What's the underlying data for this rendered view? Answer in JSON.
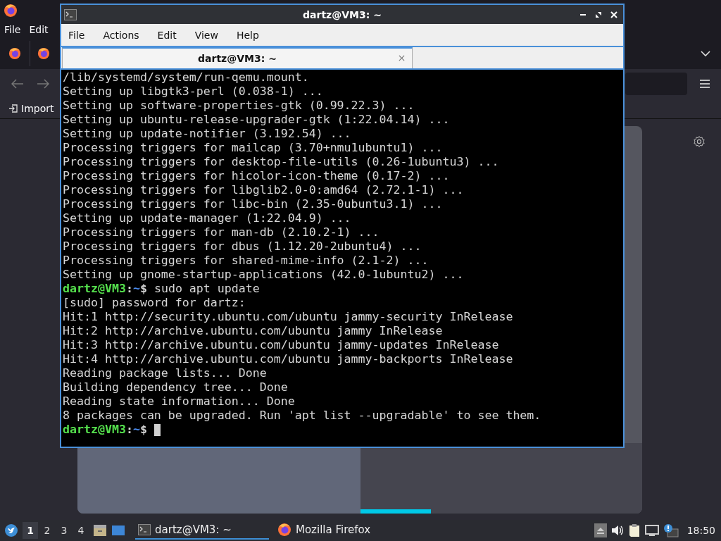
{
  "browser": {
    "menu": [
      "File",
      "Edit"
    ],
    "tabs": [
      {
        "kind": "pinned"
      },
      {
        "kind": "page"
      }
    ],
    "bookmarks": [
      "Import"
    ]
  },
  "terminal": {
    "title": "dartz@VM3: ~",
    "menu": [
      "File",
      "Actions",
      "Edit",
      "View",
      "Help"
    ],
    "tab": {
      "label": "dartz@VM3: ~"
    },
    "lines": [
      {
        "kind": "output",
        "text": "/lib/systemd/system/run-qemu.mount."
      },
      {
        "kind": "output",
        "text": "Setting up libgtk3-perl (0.038-1) ..."
      },
      {
        "kind": "output",
        "text": "Setting up software-properties-gtk (0.99.22.3) ..."
      },
      {
        "kind": "output",
        "text": "Setting up ubuntu-release-upgrader-gtk (1:22.04.14) ..."
      },
      {
        "kind": "output",
        "text": "Setting up update-notifier (3.192.54) ..."
      },
      {
        "kind": "output",
        "text": "Processing triggers for mailcap (3.70+nmu1ubuntu1) ..."
      },
      {
        "kind": "output",
        "text": "Processing triggers for desktop-file-utils (0.26-1ubuntu3) ..."
      },
      {
        "kind": "output",
        "text": "Processing triggers for hicolor-icon-theme (0.17-2) ..."
      },
      {
        "kind": "output",
        "text": "Processing triggers for libglib2.0-0:amd64 (2.72.1-1) ..."
      },
      {
        "kind": "output",
        "text": "Processing triggers for libc-bin (2.35-0ubuntu3.1) ..."
      },
      {
        "kind": "output",
        "text": "Setting up update-manager (1:22.04.9) ..."
      },
      {
        "kind": "output",
        "text": "Processing triggers for man-db (2.10.2-1) ..."
      },
      {
        "kind": "output",
        "text": "Processing triggers for dbus (1.12.20-2ubuntu4) ..."
      },
      {
        "kind": "output",
        "text": "Processing triggers for shared-mime-info (2.1-2) ..."
      },
      {
        "kind": "output",
        "text": "Setting up gnome-startup-applications (42.0-1ubuntu2) ..."
      },
      {
        "kind": "prompt",
        "user": "dartz@VM3",
        "separator": ":",
        "path": "~",
        "symbol": "$",
        "command": "sudo apt update"
      },
      {
        "kind": "output",
        "text": "[sudo] password for dartz:"
      },
      {
        "kind": "output",
        "text": "Hit:1 http://security.ubuntu.com/ubuntu jammy-security InRelease"
      },
      {
        "kind": "output",
        "text": "Hit:2 http://archive.ubuntu.com/ubuntu jammy InRelease"
      },
      {
        "kind": "output",
        "text": "Hit:3 http://archive.ubuntu.com/ubuntu jammy-updates InRelease"
      },
      {
        "kind": "output",
        "text": "Hit:4 http://archive.ubuntu.com/ubuntu jammy-backports InRelease"
      },
      {
        "kind": "output",
        "text": "Reading package lists... Done"
      },
      {
        "kind": "output",
        "text": "Building dependency tree... Done"
      },
      {
        "kind": "output",
        "text": "Reading state information... Done"
      },
      {
        "kind": "output",
        "text": "8 packages can be upgraded. Run 'apt list --upgradable' to see them."
      },
      {
        "kind": "prompt",
        "user": "dartz@VM3",
        "separator": ":",
        "path": "~",
        "symbol": "$",
        "cursor": true
      }
    ]
  },
  "taskbar": {
    "workspaces": [
      {
        "label": "1",
        "selected": true
      },
      {
        "label": "2",
        "selected": false
      },
      {
        "label": "3",
        "selected": false
      },
      {
        "label": "4",
        "selected": false
      }
    ],
    "tasks": [
      {
        "kind": "terminal",
        "label": "dartz@VM3: ~",
        "selected": true
      },
      {
        "kind": "firefox",
        "label": "Mozilla Firefox",
        "selected": false
      }
    ],
    "clock": "18:50"
  }
}
